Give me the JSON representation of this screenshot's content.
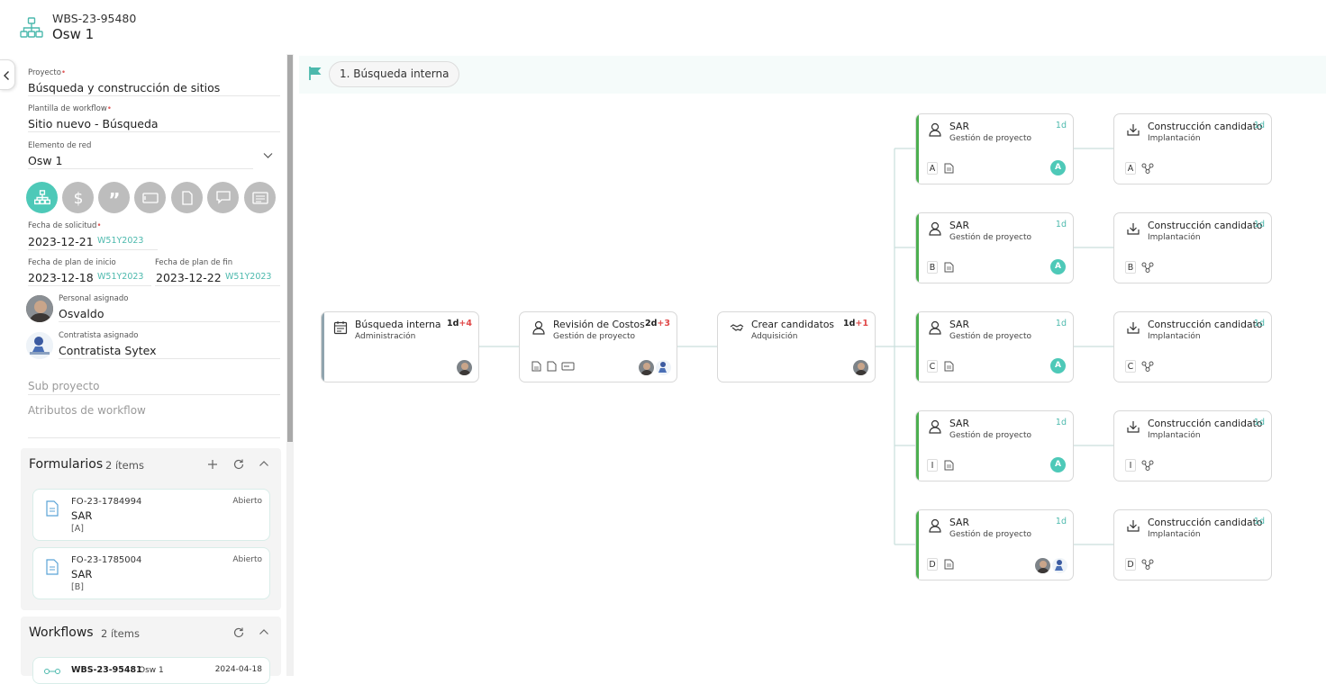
{
  "header": {
    "code": "WBS-23-95480",
    "title": "Osw 1",
    "icon": "sitemap-icon"
  },
  "fields": {
    "proyecto": {
      "label": "Proyecto",
      "value": "Búsqueda y construcción de sitios"
    },
    "plantilla": {
      "label": "Plantilla de workflow",
      "value": "Sitio nuevo - Búsqueda"
    },
    "elemento": {
      "label": "Elemento de red",
      "value": "Osw 1"
    },
    "fecha_solicitud": {
      "label": "Fecha de solicitud",
      "value": "2023-12-21",
      "week": "W51Y2023"
    },
    "fecha_inicio": {
      "label": "Fecha de plan de inicio",
      "value": "2023-12-18",
      "week": "W51Y2023"
    },
    "fecha_fin": {
      "label": "Fecha de plan de fin",
      "value": "2023-12-22",
      "week": "W51Y2023"
    },
    "personal": {
      "label": "Personal asignado",
      "value": "Osvaldo"
    },
    "contratista": {
      "label": "Contratista asignado",
      "value": "Contratista Sytex"
    },
    "sub_proyecto": "Sub proyecto",
    "atributos": "Atributos de workflow"
  },
  "toolbar_icons": [
    "sitemap-icon",
    "dollar-icon",
    "quote-icon",
    "card-icon",
    "document-icon",
    "comment-icon",
    "list-icon"
  ],
  "formularios": {
    "title": "Formularios",
    "count": "2 ítems",
    "items": [
      {
        "code": "FO-23-1784994",
        "name": "SAR",
        "sub": "[A]",
        "status": "Abierto"
      },
      {
        "code": "FO-23-1785004",
        "name": "SAR",
        "sub": "[B]",
        "status": "Abierto"
      }
    ]
  },
  "workflows": {
    "title": "Workflows",
    "count": "2 ítems",
    "items": [
      {
        "code": "WBS-23-95481",
        "name": "Osw 1",
        "date": "2024-04-18"
      }
    ]
  },
  "stage": {
    "label": "1. Búsqueda interna"
  },
  "nodes": {
    "busqueda": {
      "title": "Búsqueda interna",
      "sub": "Administración",
      "dur": "1d",
      "extra": "+4"
    },
    "revision": {
      "title": "Revisión de Costos",
      "sub": "Gestión de proyecto",
      "dur": "2d",
      "extra": "+3"
    },
    "crear": {
      "title": "Crear candidatos",
      "sub": "Adquisición",
      "dur": "1d",
      "extra": "+1"
    },
    "sar": [
      {
        "title": "SAR",
        "sub": "Gestión de proyecto",
        "dur": "1d",
        "letter": "A",
        "badge": "A"
      },
      {
        "title": "SAR",
        "sub": "Gestión de proyecto",
        "dur": "1d",
        "letter": "B",
        "badge": "A"
      },
      {
        "title": "SAR",
        "sub": "Gestión de proyecto",
        "dur": "1d",
        "letter": "C",
        "badge": "A"
      },
      {
        "title": "SAR",
        "sub": "Gestión de proyecto",
        "dur": "1d",
        "letter": "I",
        "badge": "A"
      },
      {
        "title": "SAR",
        "sub": "Gestión de proyecto",
        "dur": "1d",
        "letter": "D",
        "badge": ""
      }
    ],
    "construccion": [
      {
        "title": "Construcción candidato",
        "sub": "Implantación",
        "dur": "1d",
        "letter": "A"
      },
      {
        "title": "Construcción candidato",
        "sub": "Implantación",
        "dur": "1d",
        "letter": "B"
      },
      {
        "title": "Construcción candidato",
        "sub": "Implantación",
        "dur": "1d",
        "letter": "C"
      },
      {
        "title": "Construcción candidato",
        "sub": "Implantación",
        "dur": "1d",
        "letter": "I"
      },
      {
        "title": "Construcción candidato",
        "sub": "Implantación",
        "dur": "1d",
        "letter": "D"
      }
    ]
  },
  "colors": {
    "accent": "#4ec9b8",
    "sar_bar": "#4caf50",
    "first_bar": "#90a4ae",
    "overdue": "#e04848"
  }
}
